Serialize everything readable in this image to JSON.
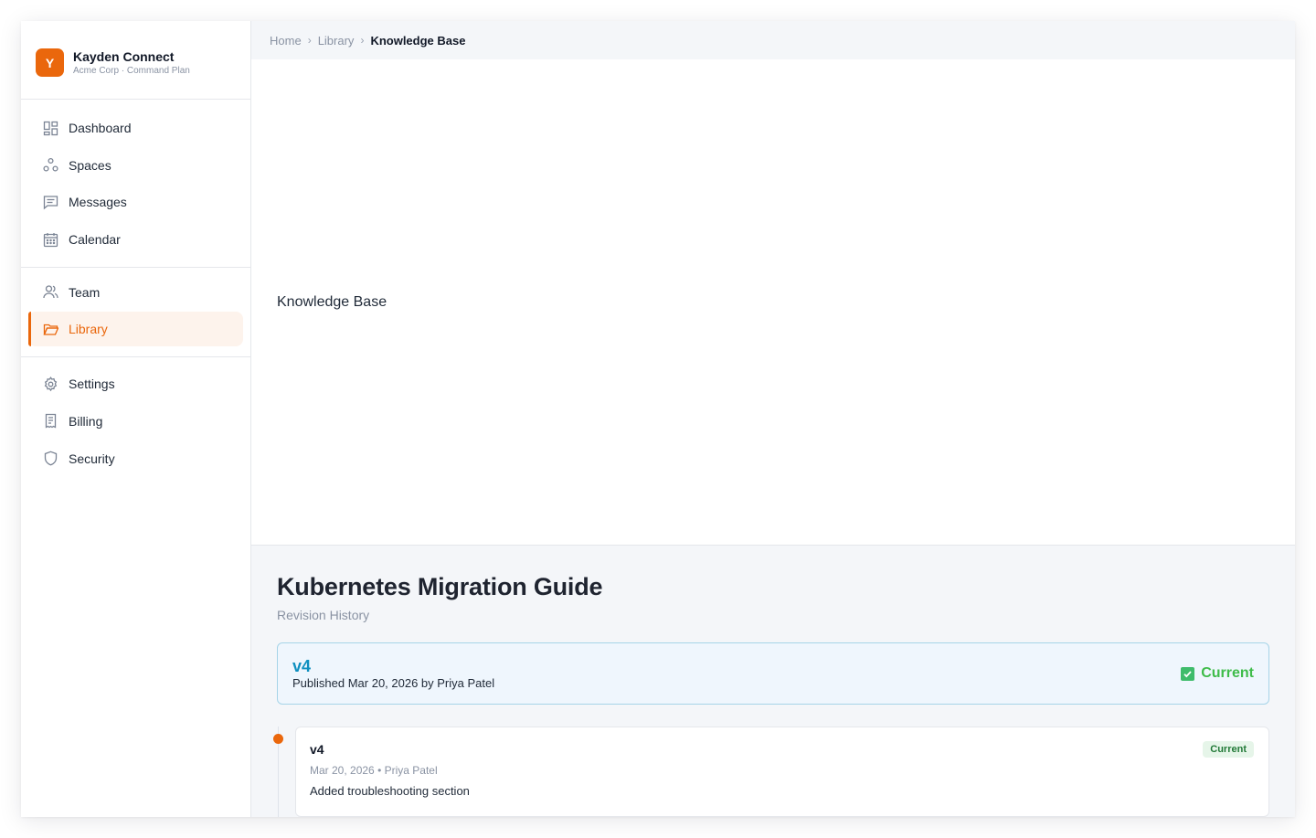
{
  "brand": {
    "logo_letter": "Y",
    "name": "Kayden Connect",
    "subtitle": "Acme Corp · Command Plan",
    "accent": "#ea670c"
  },
  "sidebar": {
    "groups": [
      {
        "items": [
          {
            "label": "Dashboard",
            "icon": "dashboard-icon"
          },
          {
            "label": "Spaces",
            "icon": "spaces-icon"
          },
          {
            "label": "Messages",
            "icon": "messages-icon"
          },
          {
            "label": "Calendar",
            "icon": "calendar-icon"
          }
        ]
      },
      {
        "items": [
          {
            "label": "Team",
            "icon": "team-icon"
          },
          {
            "label": "Library",
            "icon": "folder-icon",
            "active": true
          }
        ]
      },
      {
        "items": [
          {
            "label": "Settings",
            "icon": "gear-icon"
          },
          {
            "label": "Billing",
            "icon": "receipt-icon"
          },
          {
            "label": "Security",
            "icon": "shield-icon"
          }
        ]
      }
    ]
  },
  "breadcrumb": {
    "items": [
      "Home",
      "Library",
      "Knowledge Base"
    ]
  },
  "hero": {
    "text": "Knowledge Base"
  },
  "document": {
    "title": "Kubernetes Migration Guide",
    "subtitle": "Revision History"
  },
  "current_revision": {
    "version": "v4",
    "meta": "Published Mar 20, 2026 by Priya Patel",
    "status": "Current",
    "status_color": "#3fbc4a"
  },
  "revisions": [
    {
      "version": "v4",
      "date": "Mar 20, 2026",
      "author": "Priya Patel",
      "note": "Added troubleshooting section",
      "badge": "Current"
    }
  ]
}
